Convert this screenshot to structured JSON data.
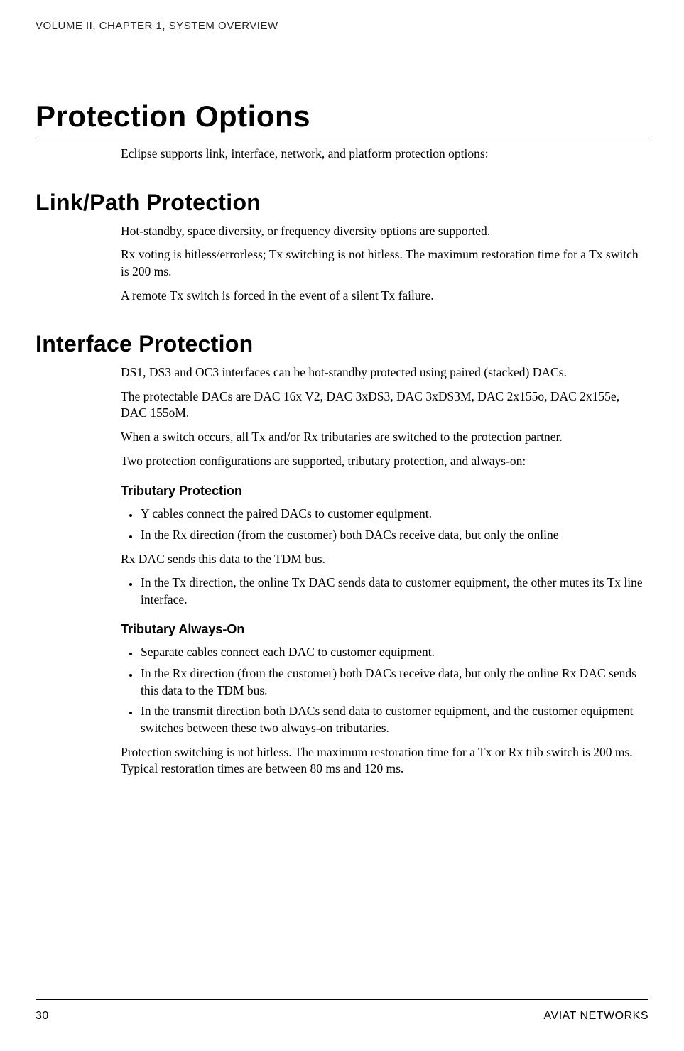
{
  "header": {
    "breadcrumb": "VOLUME II, CHAPTER 1, SYSTEM OVERVIEW"
  },
  "title": "Protection Options",
  "intro": "Eclipse supports link, interface, network, and platform protection options:",
  "sections": {
    "link": {
      "heading": "Link/Path Protection",
      "p1": "Hot-standby, space diversity, or frequency diversity options are supported.",
      "p2": "Rx voting is hitless/errorless; Tx switching is not hitless. The maximum restoration time for a Tx switch is 200 ms.",
      "p3": "A remote Tx switch is forced in the event of a silent Tx failure."
    },
    "interface": {
      "heading": "Interface Protection",
      "p1": "DS1, DS3 and OC3 interfaces can be hot-standby protected using paired (stacked) DACs.",
      "p2": "The protectable DACs are DAC 16x V2, DAC 3xDS3, DAC 3xDS3M, DAC 2x155o, DAC 2x155e, DAC 155oM.",
      "p3": "When a switch occurs, all Tx and/or Rx tributaries are switched to the protection partner.",
      "p4": "Two protection configurations are supported, tributary protection, and always-on:",
      "tributary": {
        "heading": "Tributary Protection",
        "b1": "Y cables connect the paired DACs to customer equipment.",
        "b2": "In the Rx direction (from the customer) both DACs receive data, but only the online",
        "p_after": "Rx DAC sends this data to the TDM bus.",
        "b3": "In the Tx direction, the online Tx DAC sends data to customer equipment, the other mutes its Tx line interface."
      },
      "always_on": {
        "heading": "Tributary Always-On",
        "b1": "Separate cables connect each DAC to customer equipment.",
        "b2": "In the Rx direction (from the customer) both DACs receive data, but only the online Rx DAC sends this data to the TDM bus.",
        "b3": "In the transmit direction both DACs send data to customer equipment, and the customer equipment switches between these two always-on tributaries."
      },
      "closing": "Protection switching is not hitless. The maximum restoration time for a Tx or Rx trib switch is 200 ms. Typical restoration times are between 80 ms and 120 ms."
    }
  },
  "footer": {
    "page_number": "30",
    "company": "AVIAT NETWORKS"
  }
}
